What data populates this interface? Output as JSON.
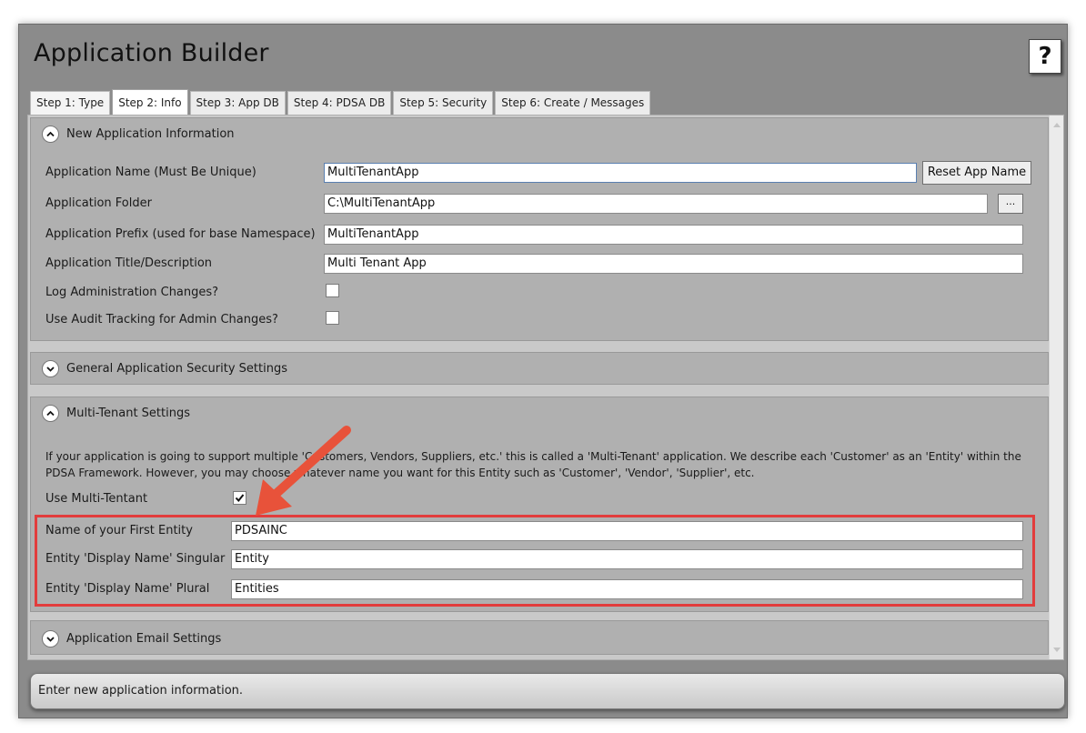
{
  "window": {
    "title": "Application Builder",
    "help_label": "?"
  },
  "tabs": [
    {
      "label": "Step 1: Type"
    },
    {
      "label": "Step 2: Info"
    },
    {
      "label": "Step 3: App DB"
    },
    {
      "label": "Step 4: PDSA DB"
    },
    {
      "label": "Step 5: Security"
    },
    {
      "label": "Step 6: Create / Messages"
    }
  ],
  "new_app_info": {
    "header": "New Application Information",
    "app_name_label": "Application Name (Must Be Unique)",
    "app_name_value": "MultiTenantApp",
    "reset_button": "Reset App Name",
    "folder_label": "Application Folder",
    "folder_value": "C:\\MultiTenantApp",
    "browse_button": "...",
    "prefix_label": "Application Prefix (used for base Namespace)",
    "prefix_value": "MultiTenantApp",
    "title_label": "Application Title/Description",
    "title_value": "Multi Tenant App",
    "log_admin_label": "Log Administration Changes?",
    "audit_label": "Use Audit Tracking for Admin Changes?"
  },
  "security_settings": {
    "header": "General Application Security Settings"
  },
  "multi_tenant": {
    "header": "Multi-Tenant Settings",
    "description": "If your application is going to support multiple 'Customers, Vendors, Suppliers, etc.' this is called a 'Multi-Tenant' application. We describe each 'Customer' as an 'Entity' within the PDSA Framework. However, you may choose whatever name you want for this Entity such as 'Customer', 'Vendor', 'Supplier', etc.",
    "use_label": "Use Multi-Tentant",
    "first_entity_label": "Name of your First Entity",
    "first_entity_value": "PDSAINC",
    "singular_label": "Entity 'Display Name' Singular",
    "singular_value": "Entity",
    "plural_label": "Entity 'Display Name' Plural",
    "plural_value": "Entities"
  },
  "email_settings": {
    "header": "Application Email Settings"
  },
  "status_bar": {
    "message": "Enter new application information."
  },
  "colors": {
    "highlight": "#e23c3c",
    "arrow": "#e8523a"
  }
}
